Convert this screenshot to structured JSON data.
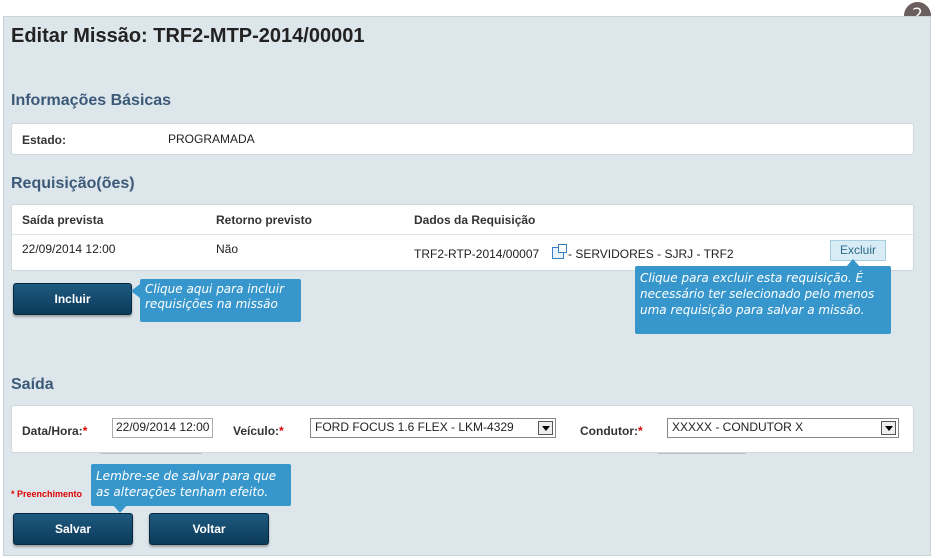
{
  "step": "2",
  "page_title": "Editar Missão: TRF2-MTP-2014/00001",
  "basic": {
    "section_title": "Informações Básicas",
    "estado_label": "Estado:",
    "estado_value": "PROGRAMADA"
  },
  "requisicoes": {
    "section_title": "Requisição(ões)",
    "columns": [
      "Saída prevista",
      "Retorno previsto",
      "Dados da Requisição"
    ],
    "row": {
      "saida": "22/09/2014 12:00",
      "retorno": "Não",
      "codigo": "TRF2-RTP-2014/00007",
      "descricao": " - SERVIDORES - SJRJ - TRF2",
      "excluir_label": "Excluir"
    },
    "incluir_label": "Incluir"
  },
  "tips": {
    "incluir_line1": "Clique aqui para  incluir",
    "incluir_line2": "requisições na missão",
    "excluir_line1": "Clique para excluir esta requisição. É",
    "excluir_line2": "necessário ter selecionado pelo menos",
    "excluir_line3": "uma requisição para salvar a missão.",
    "salvar_line1": "Lembre-se de salvar para que",
    "salvar_line2": "as alterações tenham efeito."
  },
  "saida": {
    "section_title": "Saída",
    "data_label": "Data/Hora:",
    "data_value": "22/09/2014 12:00",
    "veiculo_label": "Veículo:",
    "veiculo_value": "FORD FOCUS 1.6 FLEX - LKM-4329",
    "condutor_label": "Condutor:",
    "condutor_value": "XXXXX - CONDUTOR X",
    "required_mark": "*"
  },
  "footer": {
    "required_note": "* Preenchimento",
    "salvar_label": "Salvar",
    "voltar_label": "Voltar"
  },
  "colors": {
    "panel_bg": "#dde6ea",
    "section_title": "#3c5a78",
    "button_dark": "#0c3a59",
    "tooltip": "#3797cc",
    "required": "#dd0000"
  }
}
